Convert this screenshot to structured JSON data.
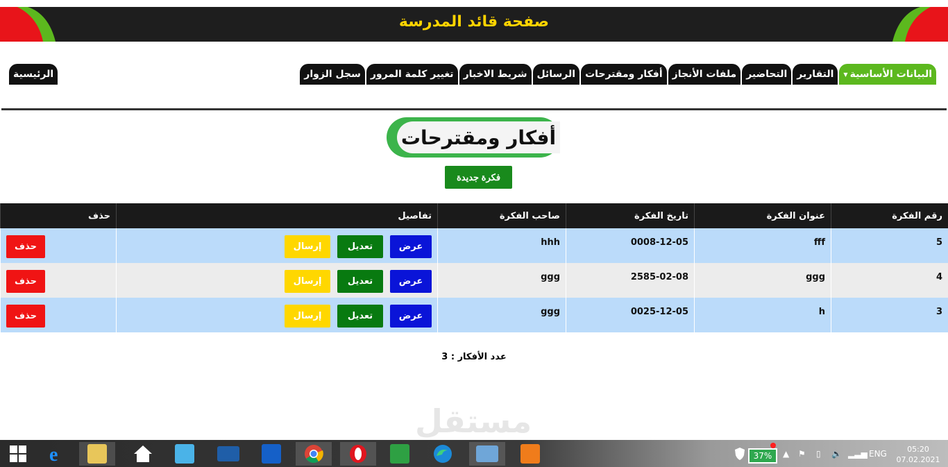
{
  "header": {
    "title": "صفحة قائد المدرسة",
    "colors": {
      "bar": "#1e1e1e",
      "title": "#ffd400",
      "corner_red": "#e8141a",
      "corner_green": "#5cb81e"
    }
  },
  "nav": {
    "items": [
      {
        "label": "البيانات الأساسية",
        "active": true,
        "has_dropdown": true
      },
      {
        "label": "التقارير"
      },
      {
        "label": "التحاضير"
      },
      {
        "label": "ملفات الأنجاز"
      },
      {
        "label": "أفكار ومقترحات"
      },
      {
        "label": "الرسائل"
      },
      {
        "label": "شريط الاخبار"
      },
      {
        "label": "تغيير كلمة المرور"
      },
      {
        "label": "سجل الزوار"
      }
    ],
    "home": "الرئيسية"
  },
  "page": {
    "heading": "أفكار ومقترحات",
    "new_button": "فكرة جديدة"
  },
  "table": {
    "columns": [
      "رقم الفكرة",
      "عنوان الفكرة",
      "تاريخ الفكرة",
      "صاحب الفكرة",
      "تفاصيل",
      "حذف"
    ],
    "rows": [
      {
        "id": "5",
        "title": "fff",
        "date": "0008-12-05",
        "owner": "hhh"
      },
      {
        "id": "4",
        "title": "ggg",
        "date": "2585-02-08",
        "owner": "ggg"
      },
      {
        "id": "3",
        "title": "h",
        "date": "0025-12-05",
        "owner": "ggg"
      }
    ],
    "actions": {
      "view": "عرض",
      "edit": "تعديل",
      "send": "إرسال",
      "delete": "حذف"
    }
  },
  "footer": {
    "count_label": "عدد الأفكار : 3"
  },
  "watermark": "مستقل",
  "taskbar": {
    "icons": [
      "windows-start",
      "internet-explorer",
      "file-explorer",
      "home",
      "store-bag",
      "lenovo-monitor",
      "maxthon",
      "chrome",
      "opera",
      "ms-store",
      "edge",
      "photos",
      "xampp"
    ],
    "battery": "37%",
    "language": "ENG",
    "time": "05:20",
    "date": "07.02.2021"
  }
}
